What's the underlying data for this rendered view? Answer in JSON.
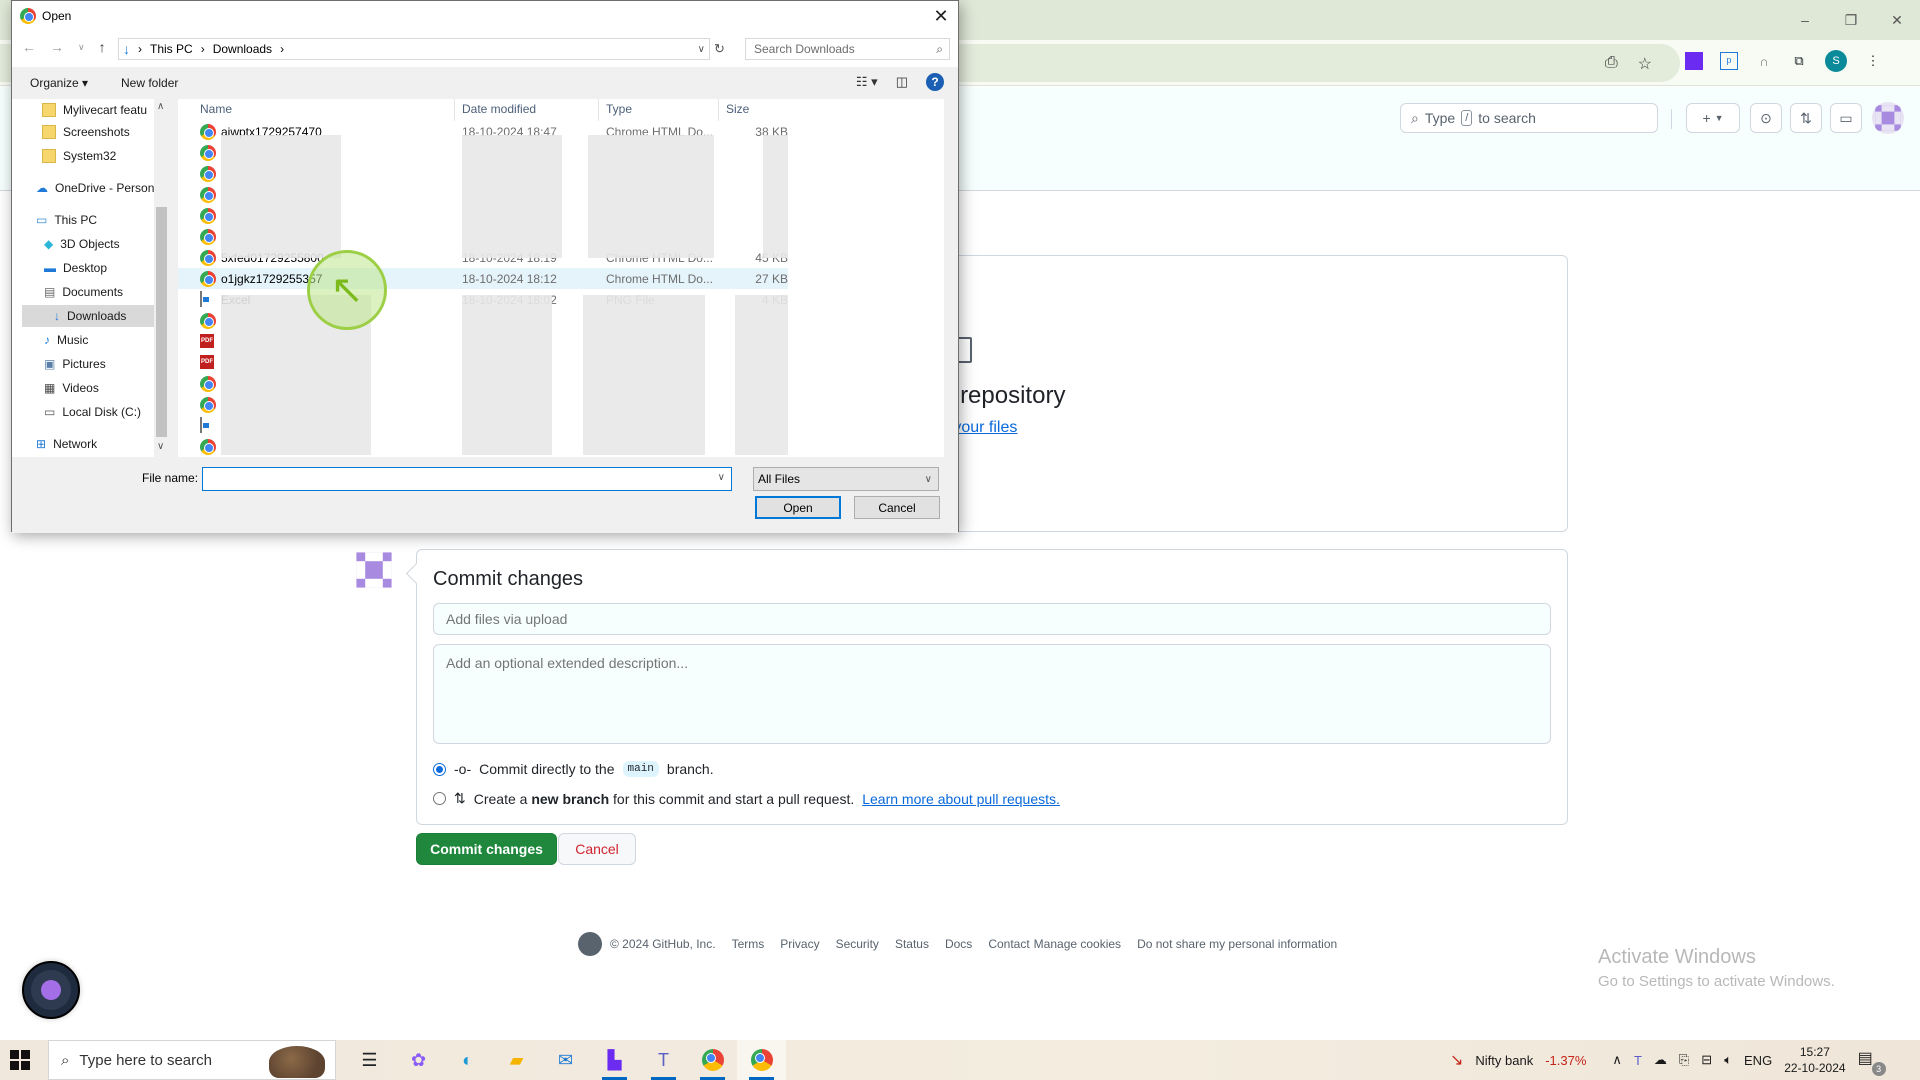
{
  "browser": {
    "window_controls": {
      "minimize": "–",
      "restore": "❐",
      "close": "✕"
    },
    "profile_initial": "S"
  },
  "github": {
    "search_prefix": "Type",
    "search_key": "/",
    "search_suffix": "to search",
    "create_label": "+",
    "upload_title": "them to your repository",
    "upload_link": "e your files",
    "commit": {
      "title": "Commit changes",
      "summary_placeholder": "Add files via upload",
      "description_placeholder": "Add an optional extended description...",
      "option_direct_pre": "Commit directly to the",
      "option_direct_branch": "main",
      "option_direct_post": "branch.",
      "option_direct_selected": true,
      "option_pr_pre": "Create a",
      "option_pr_bold": "new branch",
      "option_pr_post": "for this commit and start a pull request.",
      "option_pr_link": "Learn more about pull requests.",
      "commit_button": "Commit changes",
      "cancel_button": "Cancel"
    },
    "footer": {
      "copyright": "© 2024 GitHub, Inc.",
      "links": [
        "Terms",
        "Privacy",
        "Security",
        "Status",
        "Docs",
        "Contact",
        "Manage cookies",
        "Do not share my personal information"
      ]
    }
  },
  "activation": {
    "title": "Activate Windows",
    "subtitle": "Go to Settings to activate Windows."
  },
  "dialog": {
    "title": "Open",
    "breadcrumb": [
      "This PC",
      "Downloads"
    ],
    "search_placeholder": "Search Downloads",
    "organize_label": "Organize ▾",
    "new_folder_label": "New folder",
    "nav_items": [
      {
        "label": "Mylivecart featu",
        "icon": "folder"
      },
      {
        "label": "Screenshots",
        "icon": "folder"
      },
      {
        "label": "System32",
        "icon": "folder"
      },
      {
        "label": "OneDrive - Person",
        "icon": "cloud"
      },
      {
        "label": "This PC",
        "icon": "pc"
      },
      {
        "label": "3D Objects",
        "icon": "cube"
      },
      {
        "label": "Desktop",
        "icon": "desktop"
      },
      {
        "label": "Documents",
        "icon": "document"
      },
      {
        "label": "Downloads",
        "icon": "download",
        "selected": true
      },
      {
        "label": "Music",
        "icon": "music"
      },
      {
        "label": "Pictures",
        "icon": "pictures"
      },
      {
        "label": "Videos",
        "icon": "videos"
      },
      {
        "label": "Local Disk (C:)",
        "icon": "disk"
      },
      {
        "label": "Network",
        "icon": "network"
      }
    ],
    "columns": [
      "Name",
      "Date modified",
      "Type",
      "Size"
    ],
    "files": [
      {
        "name": "aiwptx1729257470",
        "date": "18-10-2024 18:47",
        "type": "Chrome HTML Do...",
        "size": "38 KB",
        "icon": "chrome"
      },
      {
        "name": "",
        "date": "",
        "type": "",
        "size": "",
        "icon": "chrome"
      },
      {
        "name": "",
        "date": "",
        "type": "",
        "size": "",
        "icon": "chrome"
      },
      {
        "name": "",
        "date": "",
        "type": "",
        "size": "",
        "icon": "chrome"
      },
      {
        "name": "",
        "date": "",
        "type": "",
        "size": "",
        "icon": "chrome"
      },
      {
        "name": "",
        "date": "",
        "type": "",
        "size": "",
        "icon": "chrome"
      },
      {
        "name": "5xfed01729255800",
        "date": "18-10-2024 18:19",
        "type": "Chrome HTML Do...",
        "size": "45 KB",
        "icon": "chrome"
      },
      {
        "name": "o1jgkz1729255357",
        "date": "18-10-2024 18:12",
        "type": "Chrome HTML Do...",
        "size": "27 KB",
        "icon": "chrome",
        "selected": true
      },
      {
        "name": "Excel",
        "date": "18-10-2024 18:02",
        "type": "PNG File",
        "size": "4 KB",
        "icon": "png"
      },
      {
        "name": "",
        "date": "",
        "type": "",
        "size": "",
        "icon": "chrome"
      },
      {
        "name": "",
        "date": "",
        "type": "",
        "size": "",
        "icon": "pdf"
      },
      {
        "name": "",
        "date": "",
        "type": "",
        "size": "",
        "icon": "pdf"
      },
      {
        "name": "",
        "date": "",
        "type": "",
        "size": "",
        "icon": "chrome"
      },
      {
        "name": "",
        "date": "",
        "type": "",
        "size": "",
        "icon": "chrome"
      },
      {
        "name": "",
        "date": "",
        "type": "",
        "size": "",
        "icon": "png"
      },
      {
        "name": "",
        "date": "",
        "type": "",
        "size": "",
        "icon": "chrome"
      }
    ],
    "file_name_label": "File name:",
    "file_name_value": "",
    "filter_value": "All Files",
    "open_button": "Open",
    "cancel_button": "Cancel"
  },
  "taskbar": {
    "search_placeholder": "Type here to search",
    "apps": [
      "task-view",
      "copilot",
      "edge",
      "file-explorer",
      "mail",
      "app-purple",
      "teams",
      "chrome-profile-a",
      "chrome-profile-s"
    ],
    "nifty_label": "Nifty bank",
    "nifty_change": "-1.37%",
    "language": "ENG",
    "time": "15:27",
    "date": "22-10-2024",
    "notification_count": "3"
  }
}
